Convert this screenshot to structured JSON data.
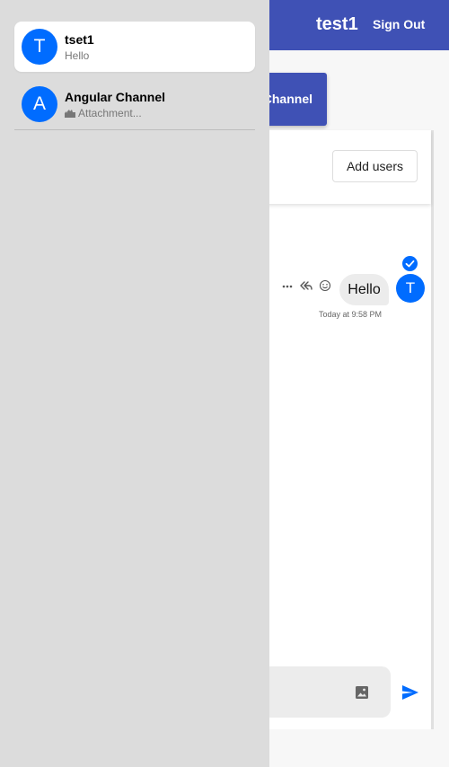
{
  "header": {
    "username": "test1",
    "sign_out_label": "Sign Out"
  },
  "create_channel": {
    "label": "Channel"
  },
  "chat": {
    "add_users_label": "Add users",
    "message": {
      "text": "Hello",
      "avatar_initial": "T",
      "timestamp": "Today at 9:58 PM"
    },
    "composer": {
      "value": ""
    }
  },
  "channels": [
    {
      "name": "tset1",
      "preview": "Hello",
      "initial": "T",
      "active": true
    },
    {
      "name": "Angular Channel",
      "preview": "Attachment...",
      "initial": "A",
      "active": false
    }
  ],
  "icons": {
    "more": "more-horizontal-icon",
    "reply": "reply-all-icon",
    "reaction": "smiley-icon",
    "read": "check-circle-icon",
    "image": "image-icon",
    "send": "send-icon",
    "attachment": "attachment-icon"
  },
  "colors": {
    "primary": "#3f51b5",
    "avatar": "#006cff",
    "drawer": "#dcdcdc",
    "bubble": "#ececec"
  }
}
